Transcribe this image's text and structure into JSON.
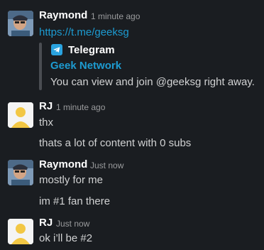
{
  "messages": [
    {
      "author": "Raymond",
      "time": "1 minute ago",
      "link": "https://t.me/geeksg",
      "unfurl": {
        "service": "Telegram",
        "title": "Geek Network",
        "description": "You can view and join @geeksg right away."
      }
    },
    {
      "author": "RJ",
      "time": "1 minute ago",
      "lines": [
        "thx",
        "thats a lot of content with 0 subs"
      ]
    },
    {
      "author": "Raymond",
      "time": "Just now",
      "lines": [
        "mostly for me",
        "im #1 fan there"
      ]
    },
    {
      "author": "RJ",
      "time": "Just now",
      "lines": [
        "ok i’ll be #2"
      ]
    }
  ],
  "colors": {
    "background": "#1a1d21",
    "link": "#1d9bd1",
    "telegram": "#2aa3df",
    "default_avatar": "#f2c744"
  }
}
